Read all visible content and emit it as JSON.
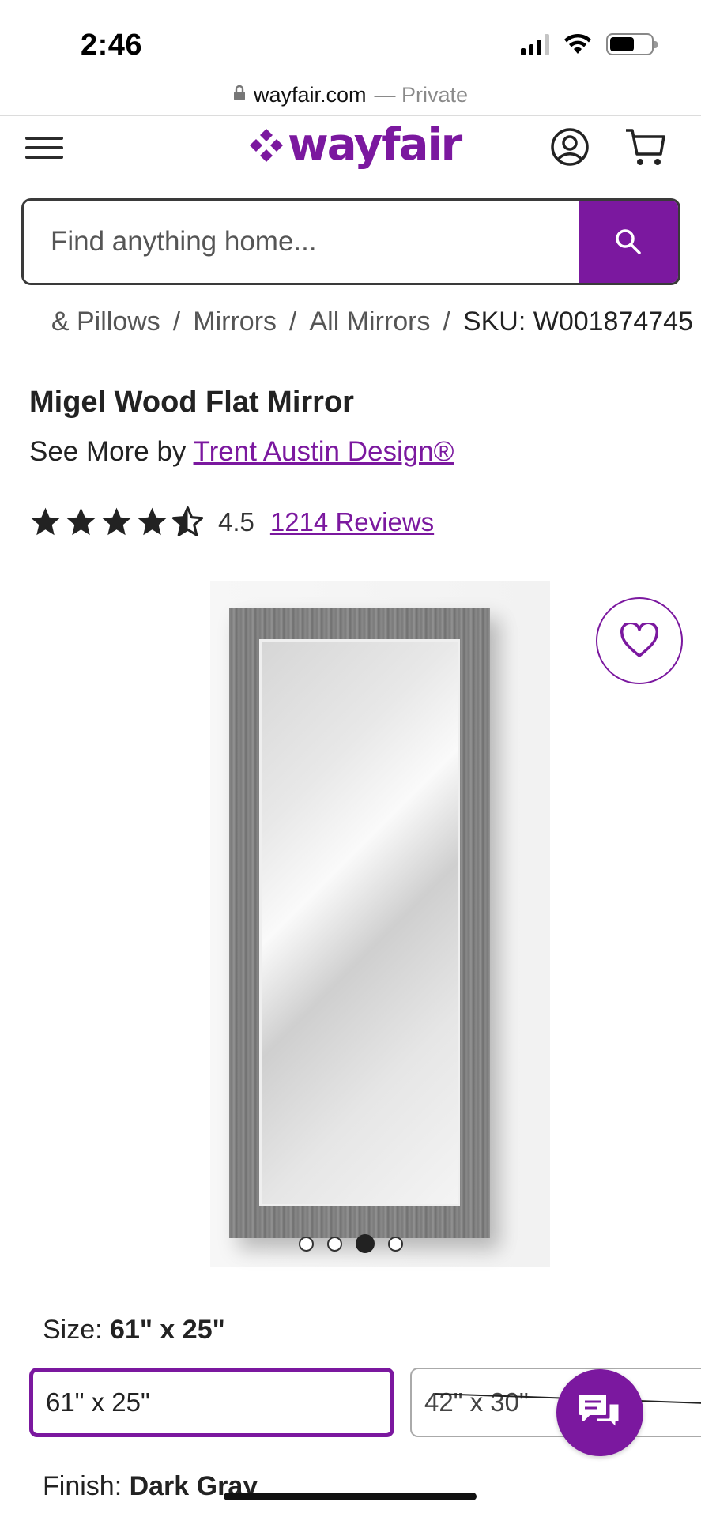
{
  "status_bar": {
    "time": "2:46"
  },
  "browser": {
    "domain": "wayfair.com",
    "private_label": "— Private"
  },
  "header": {
    "logo_text": "wayfair",
    "brand_color": "#7b189f"
  },
  "search": {
    "placeholder": "Find anything home..."
  },
  "breadcrumb": {
    "items": [
      "& Pillows",
      "Mirrors",
      "All Mirrors"
    ],
    "separator": "/",
    "current": "SKU: W001874745"
  },
  "product": {
    "title": "Migel Wood Flat Mirror",
    "brand_prefix": "See More by",
    "brand_name": "Trent Austin Design®",
    "rating": "4.5",
    "rating_fraction": 0.9,
    "reviews": "1214 Reviews"
  },
  "gallery": {
    "dot_count": 4,
    "active_dot": 3
  },
  "options": {
    "size_label": "Size:",
    "size_value": "61\" x 25\"",
    "sizes": [
      "61\" x 25\"",
      "42\" x 30\""
    ],
    "finish_label": "Finish:",
    "finish_value": "Dark Gray"
  },
  "icons": {
    "menu": "hamburger-icon",
    "account": "account-icon",
    "cart": "cart-icon",
    "search": "search-icon",
    "favorite": "heart-icon",
    "chat": "chat-icon"
  }
}
